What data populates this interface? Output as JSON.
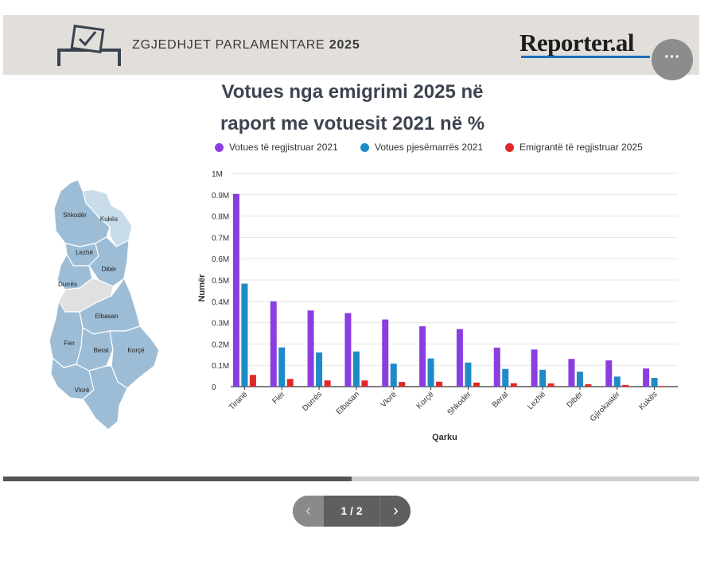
{
  "banner": {
    "title_prefix": "ZGJEDHJET PARLAMENTARE",
    "title_year": "2025",
    "brand": "Reporter.al",
    "more_label": "···",
    "icon": "ballot-box-icon"
  },
  "map": {
    "labels": [
      "Shkodër",
      "Kukës",
      "Lezhë",
      "Dibër",
      "Durrës",
      "Elbasan",
      "Fier",
      "Berat",
      "Korçë",
      "Vlorë"
    ],
    "colors": {
      "region": "#9dbdd6",
      "highlight": "#c9dcea",
      "gray": "#e0e0e0",
      "border": "#ffffff"
    }
  },
  "chart_data": {
    "type": "bar",
    "title": [
      "Votues nga emigrimi 2025 në",
      "raport me votuesit 2021 në %"
    ],
    "xlabel": "Qarku",
    "ylabel": "Numër",
    "ylim": [
      0,
      1000000
    ],
    "yticks": [
      "0",
      "0.1M",
      "0.2M",
      "0.3M",
      "0.4M",
      "0.5M",
      "0.6M",
      "0.7M",
      "0.8M",
      "0.9M",
      "1M"
    ],
    "grid": true,
    "legend_position": "top",
    "categories": [
      "Tiranë",
      "Fier",
      "Durrës",
      "Elbasan",
      "Vlorë",
      "Korçë",
      "Shkodër",
      "Berat",
      "Lezhë",
      "Dibër",
      "Gjirokastër",
      "Kukës"
    ],
    "series": [
      {
        "name": "Votues të regjistruar 2021",
        "color": "#8a3ee0",
        "values": [
          904000,
          400000,
          357000,
          345000,
          315000,
          283000,
          270000,
          183000,
          174000,
          130000,
          123000,
          85000
        ]
      },
      {
        "name": "Votues pjesëmarrës 2021",
        "color": "#1f8ac8",
        "values": [
          483000,
          184000,
          160000,
          165000,
          108000,
          132000,
          113000,
          83000,
          79000,
          70000,
          47000,
          41000
        ]
      },
      {
        "name": "Emigrantë të regjistruar 2025",
        "color": "#e0282a",
        "values": [
          55000,
          36000,
          29000,
          29000,
          22000,
          23000,
          19000,
          16000,
          15000,
          11000,
          8000,
          3000
        ]
      }
    ]
  },
  "pager": {
    "prev": "‹",
    "counter": "1 / 2",
    "next": "›",
    "progress": 0.5
  }
}
